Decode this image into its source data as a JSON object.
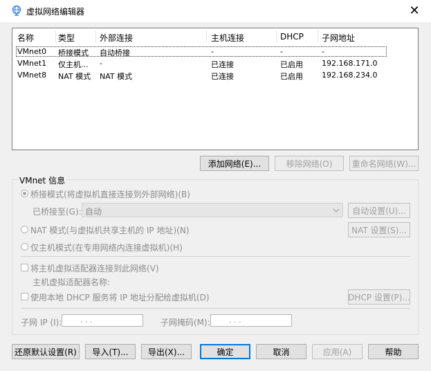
{
  "window": {
    "title": "虚拟网络编辑器",
    "close_glyph": "✕"
  },
  "table": {
    "columns": [
      "名称",
      "类型",
      "外部连接",
      "主机连接",
      "DHCP",
      "子网地址"
    ],
    "rows": [
      {
        "name": "VMnet0",
        "type": "桥接模式",
        "external": "自动桥接",
        "host": "-",
        "dhcp": "-",
        "subnet": "-"
      },
      {
        "name": "VMnet1",
        "type": "仅主机...",
        "external": "-",
        "host": "已连接",
        "dhcp": "已启用",
        "subnet": "192.168.171.0"
      },
      {
        "name": "VMnet8",
        "type": "NAT 模式",
        "external": "NAT 模式",
        "host": "已连接",
        "dhcp": "已启用",
        "subnet": "192.168.234.0"
      }
    ]
  },
  "network_buttons": {
    "add": "添加网络(E)...",
    "remove": "移除网络(O)",
    "rename": "重命名网络(W)..."
  },
  "vmnet_info": {
    "title": "VMnet 信息",
    "bridge_radio": "桥接模式(将虚拟机直接连接到外部网络)(B)",
    "bridged_to_label": "已桥接至(G):",
    "bridged_to_value": "自动",
    "auto_settings": "自动设置(U)...",
    "nat_radio": "NAT 模式(与虚拟机共享主机的 IP 地址)(N)",
    "nat_settings": "NAT 设置(S)...",
    "host_only_radio": "仅主机模式(在专用网络内连接虚拟机)(H)",
    "connect_adapter_check": "将主机虚拟适配器连接到此网络(V)",
    "adapter_name_label": "主机虚拟适配器名称:",
    "dhcp_check": "使用本地 DHCP 服务将 IP 地址分配给虚拟机(D)",
    "dhcp_settings": "DHCP 设置(P)...",
    "subnet_ip_label": "子网 IP (I):",
    "subnet_mask_label": "子网掩码(M):",
    "ip_dots": ".        .        ."
  },
  "footer": {
    "restore": "还原默认设置(R)",
    "import": "导入(T)...",
    "export": "导出(X)...",
    "ok": "确定",
    "cancel": "取消",
    "apply": "应用(A)",
    "help": "帮助"
  },
  "colors": {
    "accent": "#0078d7",
    "disabled_text": "#a0a0a0",
    "icon": "#2b7cd3"
  }
}
